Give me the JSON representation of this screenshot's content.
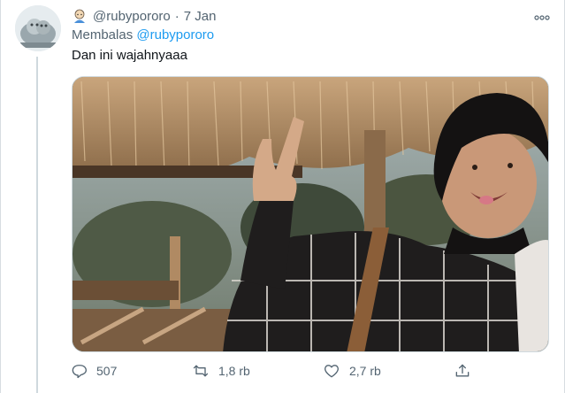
{
  "tweet": {
    "author_handle": "@rubypororo",
    "separator": "·",
    "date": "7 Jan",
    "more_icon": "more-icon",
    "reply_label": "Membalas",
    "reply_mention": "@rubypororo",
    "text": "Dan ini wajahnyaaa"
  },
  "actions": {
    "reply_count": "507",
    "retweet_count": "1,8 rb",
    "like_count": "2,7 rb"
  },
  "icons": {
    "reply": "reply-icon",
    "retweet": "retweet-icon",
    "like": "heart-icon",
    "share": "share-icon"
  },
  "colors": {
    "accent": "#1d9bf0",
    "muted": "#536471"
  }
}
